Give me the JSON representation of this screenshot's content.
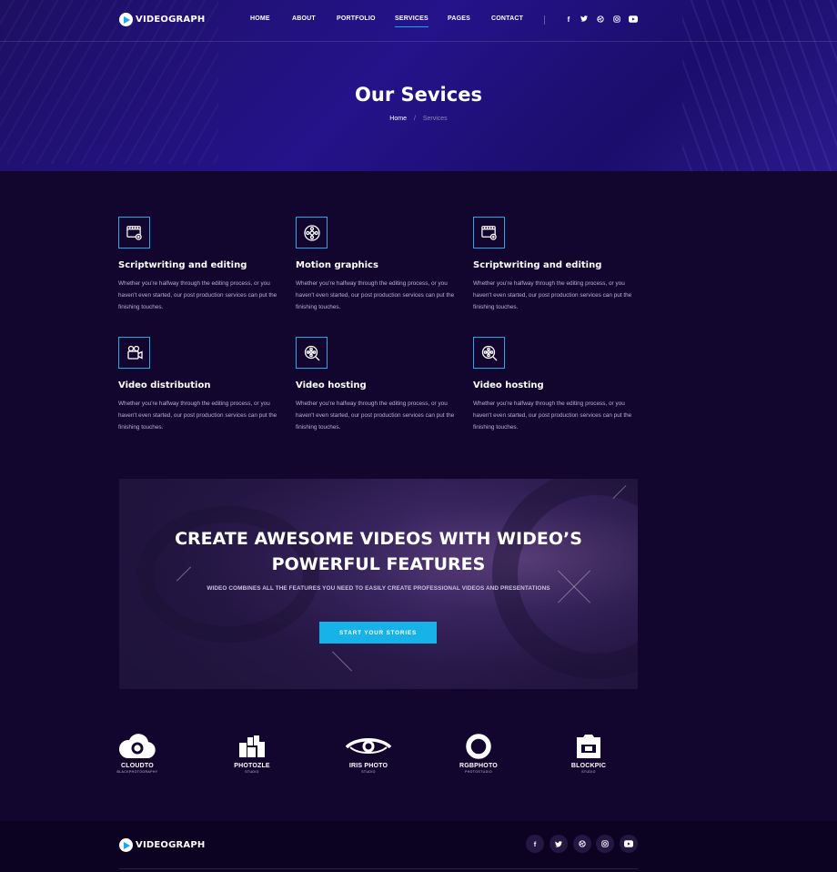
{
  "brand": {
    "name": "VIDEOGRAPH"
  },
  "nav": {
    "items": [
      {
        "label": "HOME"
      },
      {
        "label": "ABOUT"
      },
      {
        "label": "PORTFOLIO"
      },
      {
        "label": "SERVICES",
        "active": true
      },
      {
        "label": "PAGES"
      },
      {
        "label": "CONTACT"
      }
    ],
    "social": [
      "facebook-icon",
      "twitter-icon",
      "dribbble-icon",
      "instagram-icon",
      "youtube-icon"
    ]
  },
  "hero": {
    "title": "Our Sevices",
    "breadcrumb": {
      "home": "Home",
      "separator": "/",
      "current": "Services"
    }
  },
  "services": [
    {
      "icon": "storyboard-icon",
      "title": "Scriptwriting and editing",
      "description": "Whether you're halfway through the editing process, or you haven't even started, our post production services can put the finishing touches."
    },
    {
      "icon": "film-reel-icon",
      "title": "Motion graphics",
      "description": "Whether you're halfway through the editing process, or you haven't even started, our post production services can put the finishing touches."
    },
    {
      "icon": "storyboard-icon",
      "title": "Scriptwriting and editing",
      "description": "Whether you're halfway through the editing process, or you haven't even started, our post production services can put the finishing touches."
    },
    {
      "icon": "video-camera-icon",
      "title": "Video distribution",
      "description": "Whether you're halfway through the editing process, or you haven't even started, our post production services can put the finishing touches."
    },
    {
      "icon": "reel-search-icon",
      "title": "Video hosting",
      "description": "Whether you're halfway through the editing process, or you haven't even started, our post production services can put the finishing touches."
    },
    {
      "icon": "reel-search-icon",
      "title": "Video hosting",
      "description": "Whether you're halfway through the editing process, or you haven't even started, our post production services can put the finishing touches."
    }
  ],
  "banner": {
    "title_line1": "CREATE AWESOME VIDEOS WITH WIDEO’S",
    "title_line2": "POWERFUL FEATURES",
    "subtitle": "WIDEO COMBINES ALL THE FEATURES YOU NEED TO EASILY CREATE PROFESSIONAL VIDEOS AND PRESENTATIONS",
    "button_label": "START YOUR STORIES"
  },
  "partners": [
    {
      "name": "CLOUDTO",
      "sub": "BLACKPHOTOGRAPHY",
      "icon": "cloud-camera-icon"
    },
    {
      "name": "PHOTOZLE",
      "sub": "STUDIO",
      "icon": "puzzle-blocks-icon"
    },
    {
      "name": "IRIS PHOTO",
      "sub": "STUDIO",
      "icon": "eye-icon"
    },
    {
      "name": "RGBPHOTO",
      "sub": "PHOTOSTUDIO",
      "icon": "ring-icon"
    },
    {
      "name": "BLOCKPIC",
      "sub": "STUDIO",
      "icon": "block-camera-icon"
    }
  ],
  "footer": {
    "brand": "VIDEOGRAPH",
    "social": [
      "facebook-icon",
      "twitter-icon",
      "dribbble-icon",
      "instagram-icon",
      "youtube-icon"
    ]
  },
  "colors": {
    "accent": "#17b3e8",
    "background": "#12062e",
    "hero": "#24138a"
  }
}
